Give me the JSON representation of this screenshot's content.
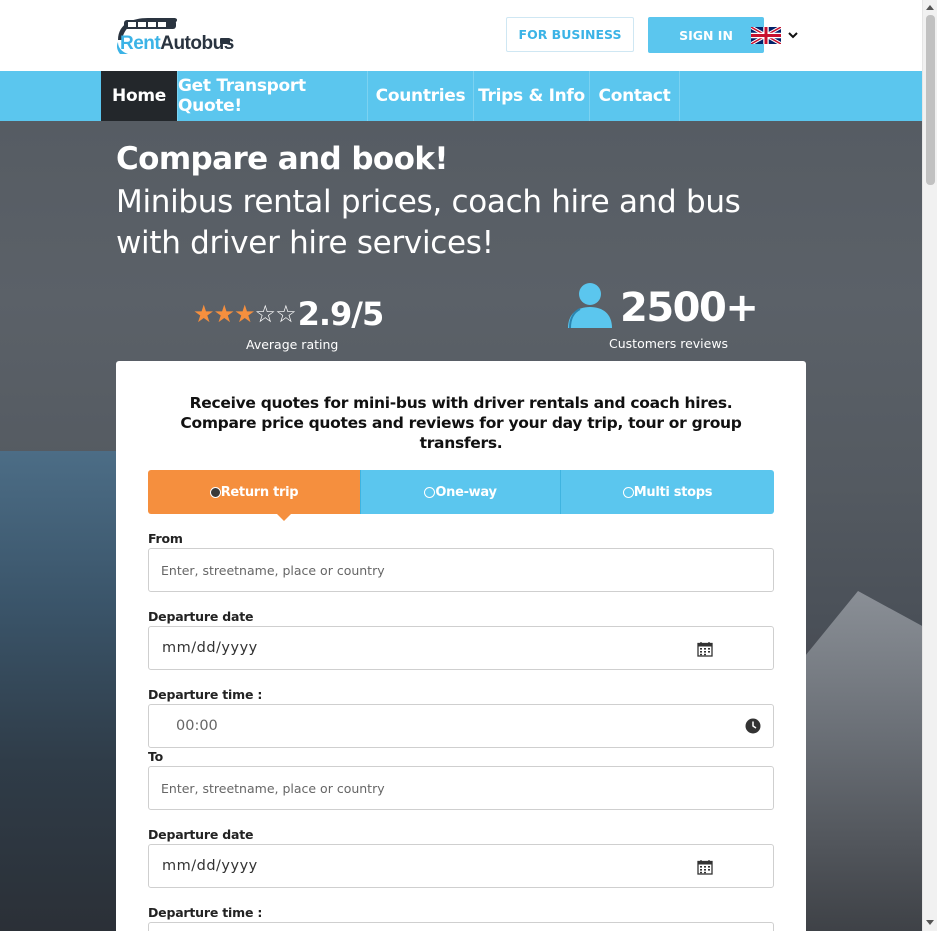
{
  "brand": {
    "logo_part1": "Rent",
    "logo_part2": "Autobus",
    "accent_color": "#5bc6ee",
    "cta_color": "#f58f3e"
  },
  "header": {
    "business_label": "FOR BUSINESS",
    "signin_label": "SIGN IN",
    "language_icon": "uk-flag-icon"
  },
  "nav": {
    "items": [
      {
        "label": "Home"
      },
      {
        "label": "Get Transport Quote!"
      },
      {
        "label": "Countries"
      },
      {
        "label": "Trips & Info"
      },
      {
        "label": "Contact"
      }
    ],
    "active_index": 0
  },
  "hero": {
    "title": "Compare and book!",
    "subtitle": "Minibus rental prices, coach hire and bus with driver hire services!",
    "rating": {
      "stars_filled": 3,
      "stars_total": 5,
      "value": "2.9/5",
      "label": "Average rating"
    },
    "reviews": {
      "value": "2500+",
      "label": "Customers reviews"
    }
  },
  "form": {
    "intro": "Receive quotes for mini-bus with driver rentals and coach hires. Compare price quotes and reviews for your day trip, tour or group transfers.",
    "trip_types": [
      {
        "label": "Return trip",
        "selected": true
      },
      {
        "label": "One-way",
        "selected": false
      },
      {
        "label": "Multi stops",
        "selected": false
      }
    ],
    "from_label": "From",
    "from_placeholder": "Enter, streetname, place or country",
    "departure_date_label": "Departure date",
    "departure_date_value": "mm/dd/yyyy",
    "departure_time_label": "Departure time :",
    "departure_time_value": "00:00",
    "to_label": "To",
    "to_placeholder": "Enter, streetname, place or country",
    "return_date_label": "Departure date",
    "return_date_value": "mm/dd/yyyy",
    "return_time_label": "Departure time :"
  }
}
